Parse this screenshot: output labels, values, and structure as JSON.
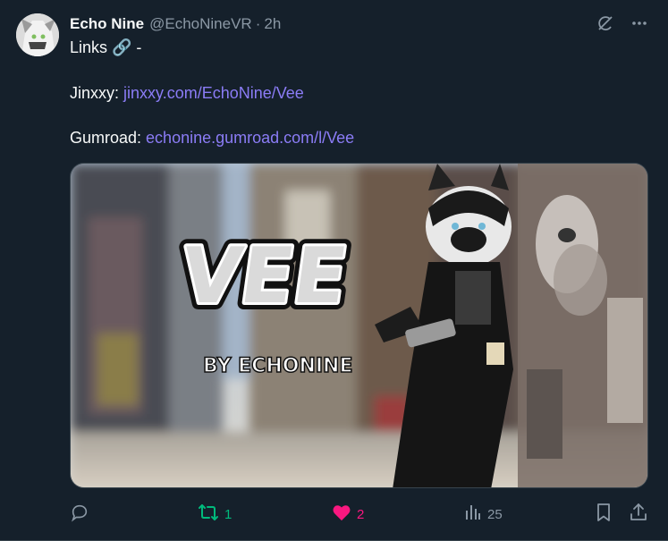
{
  "tweet": {
    "author_name": "Echo Nine",
    "handle": "@EchoNineVR",
    "separator": "·",
    "time": "2h",
    "line1_text": "Links 🔗 -",
    "jinxxy_label": "Jinxxy: ",
    "jinxxy_link": "jinxxy.com/EchoNine/Vee",
    "gumroad_label": "Gumroad: ",
    "gumroad_link": "echonine.gumroad.com/l/Vee",
    "media": {
      "logo_text": "VEE",
      "logo_subtext": "BY ECHONINE"
    }
  },
  "actions": {
    "replies": "",
    "reposts": "1",
    "likes": "2",
    "views": "25"
  },
  "colors": {
    "background": "#15202b",
    "link": "#8b7cf6",
    "repost_green": "#00ba7c",
    "like_pink": "#f91880",
    "muted": "#8b98a5"
  },
  "icons": [
    "grok-icon",
    "more-icon",
    "reply-icon",
    "repost-icon",
    "like-icon",
    "views-icon",
    "bookmark-icon",
    "share-icon"
  ]
}
